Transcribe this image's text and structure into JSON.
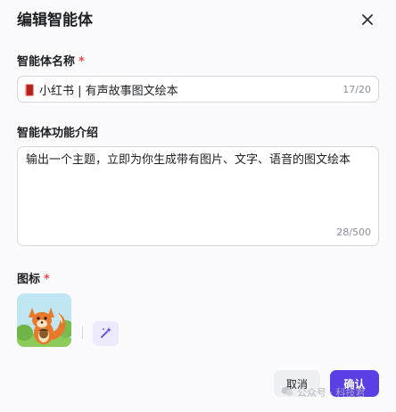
{
  "dialog": {
    "title": "编辑智能体",
    "close_icon": "close-icon"
  },
  "name_field": {
    "label": "智能体名称",
    "required_mark": "*",
    "emoji_icon": "red-book-icon",
    "value": "小红书 | 有声故事图文绘本",
    "counter": "17/20"
  },
  "description_field": {
    "label": "智能体功能介绍",
    "value": "输出一个主题，立即为你生成带有图片、文字、语音的图文绘本",
    "counter": "28/500"
  },
  "icon_field": {
    "label": "图标",
    "required_mark": "*",
    "image_icon": "fox-avatar-icon",
    "generate_icon": "magic-sparkle-icon"
  },
  "footer": {
    "cancel_label": "取消",
    "confirm_label": "确认"
  },
  "watermark": {
    "text": "公众号 · 科技君"
  },
  "colors": {
    "accent": "#5b3fe4",
    "required": "#f54a45",
    "magic_bg": "#edeafd"
  }
}
